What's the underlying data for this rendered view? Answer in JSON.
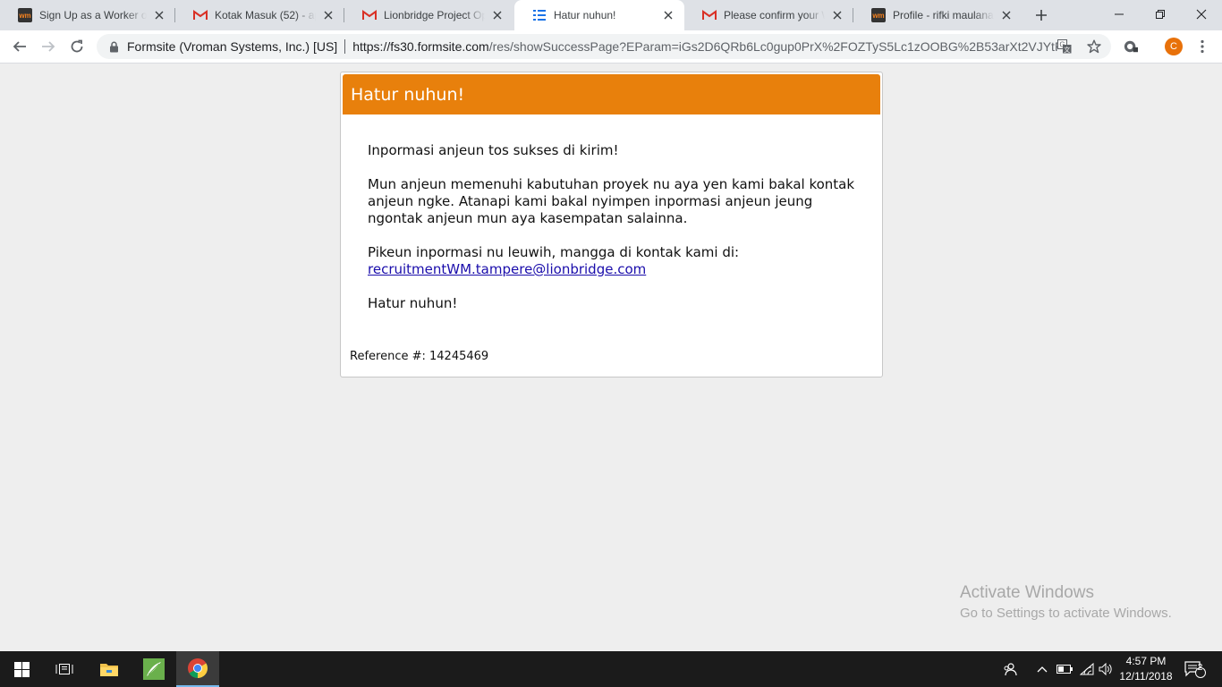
{
  "browser": {
    "tabs": [
      {
        "title": "Sign Up as a Worker on",
        "favicon": "workmarket-icon",
        "active": false
      },
      {
        "title": "Kotak Masuk (52) - app",
        "favicon": "gmail-icon",
        "active": false
      },
      {
        "title": "Lionbridge Project Opp",
        "favicon": "gmail-icon",
        "active": false
      },
      {
        "title": "Hatur nuhun!",
        "favicon": "formsite-icon",
        "active": true
      },
      {
        "title": "Please confirm your Wo",
        "favicon": "gmail-icon",
        "active": false
      },
      {
        "title": "Profile - rifki maulana -",
        "favicon": "workmarket-icon",
        "active": false
      }
    ],
    "site_identity": "Formsite (Vroman Systems, Inc.) [US]",
    "url_host": "https://fs30.formsite.com",
    "url_path": "/res/showSuccessPage?EParam=iGs2D6QRb6Lc0gup0PrX%2FOZTyS5Lc1zOOBG%2B53arXt2VJYtPUw...",
    "profile_initial": "C",
    "accent": "#e8710a"
  },
  "page": {
    "header_title": "Hatur nuhun!",
    "header_color": "#e8800c",
    "para1": "Inpormasi anjeun tos sukses di kirim!",
    "para2": "Mun anjeun memenuhi kabutuhan proyek nu aya yen kami bakal kontak anjeun ngke. Atanapi kami bakal nyimpen inpormasi anjeun jeung ngontak anjeun mun aya kasempatan salainna.",
    "para3": "Pikeun inpormasi nu leuwih, mangga di kontak kami di:",
    "email": "recruitmentWM.tampere@lionbridge.com",
    "para4": "Hatur nuhun!",
    "reference": "Reference #: 14245469"
  },
  "watermark": {
    "line1": "Activate Windows",
    "line2": "Go to Settings to activate Windows."
  },
  "taskbar": {
    "time": "4:57 PM",
    "date": "12/11/2018",
    "notification_count": "2"
  }
}
